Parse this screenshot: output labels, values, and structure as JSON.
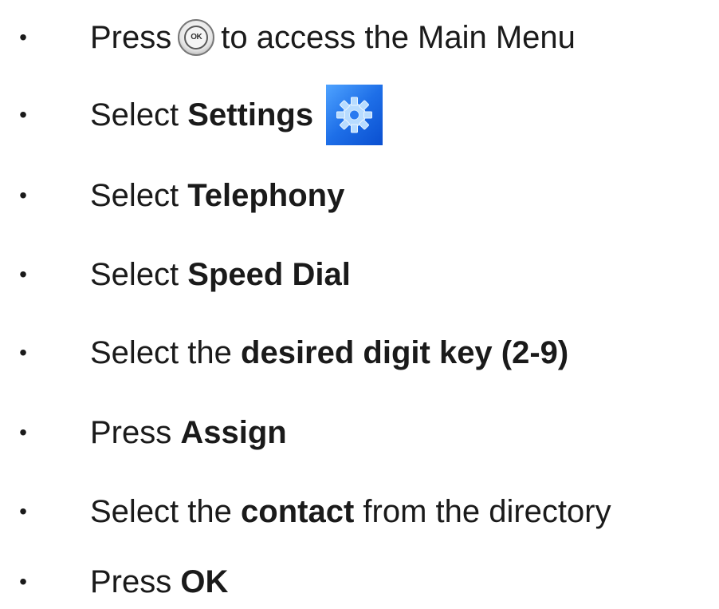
{
  "steps": [
    {
      "pre": "Press",
      "icon": "ok-button-icon",
      "post": "to access the Main Menu"
    },
    {
      "pre": "Select",
      "bold": "Settings",
      "icon": "settings-gear-icon"
    },
    {
      "pre": "Select",
      "bold": "Telephony"
    },
    {
      "pre": "Select",
      "bold": "Speed Dial"
    },
    {
      "pre": "Select the",
      "bold": "desired digit key (2-9)"
    },
    {
      "pre": "Press",
      "bold": "Assign"
    },
    {
      "pre": "Select the",
      "bold": "contact",
      "post": "from the directory"
    },
    {
      "pre": "Press",
      "bold": "OK"
    }
  ],
  "ok_icon_label": "OK",
  "bullet": "•"
}
